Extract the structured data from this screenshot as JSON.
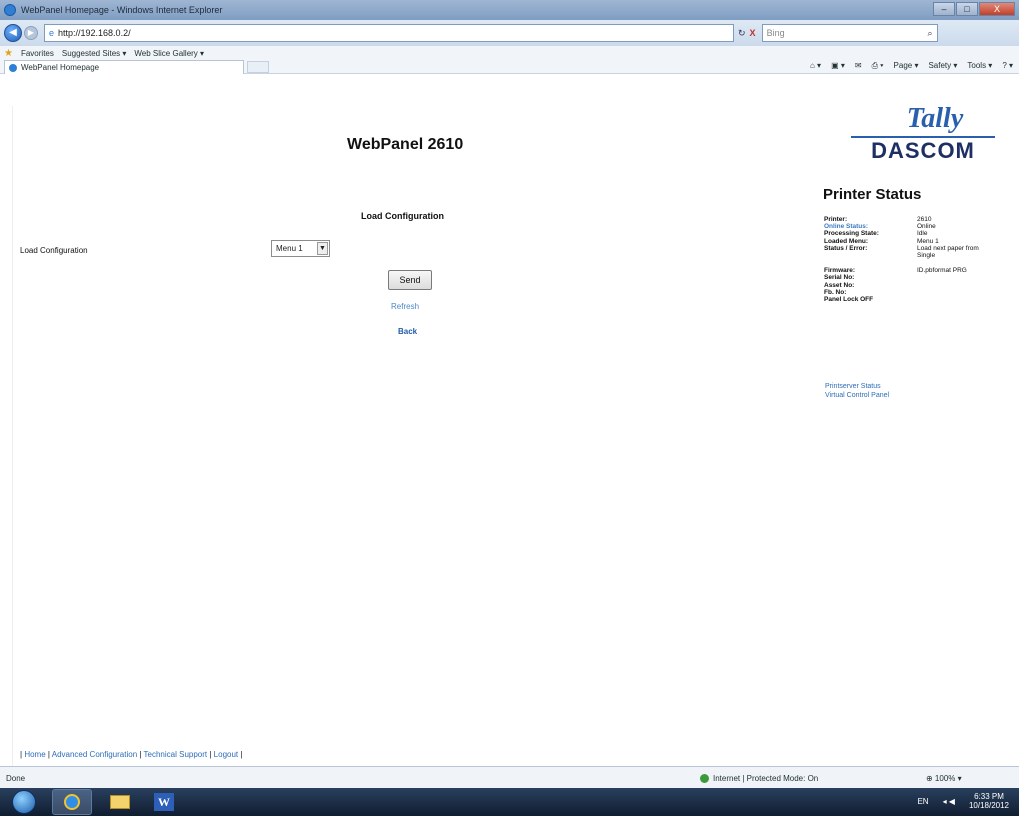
{
  "window": {
    "title": "WebPanel Homepage - Windows Internet Explorer",
    "minimize": "–",
    "maximize": "□",
    "close": "X"
  },
  "addressbar": {
    "back": "◀",
    "forward": "▶",
    "url": "http://192.168.0.2/",
    "search_placeholder": "Bing",
    "refresh": "↻",
    "stop": "X"
  },
  "favorites": {
    "favorites_label": "Favorites",
    "suggested_sites": "Suggested Sites ▾",
    "web_slice_gallery": "Web Slice Gallery ▾"
  },
  "tabs": [
    {
      "label": "WebPanel Homepage"
    }
  ],
  "commandbar": {
    "home": "⌂ ▾",
    "feeds": "▣ ▾",
    "mail": "✉",
    "print": "⎙ ▾",
    "page": "Page ▾",
    "safety": "Safety ▾",
    "tools": "Tools ▾",
    "help": "? ▾"
  },
  "page": {
    "title": "WebPanel 2610",
    "section_title": "Load Configuration",
    "config_label": "Load Configuration",
    "config_selected": "Menu 1",
    "send_label": "Send",
    "refresh_label": "Refresh",
    "back_label": "Back"
  },
  "logo": {
    "tally": "Tally",
    "dascom": "DASCOM"
  },
  "printer_status": {
    "title": "Printer Status",
    "rows": [
      {
        "key": "Printer:",
        "value": "2610"
      },
      {
        "key": "Online Status:",
        "value": "Online"
      },
      {
        "key": "Processing State:",
        "value": "Idle"
      },
      {
        "key": "Loaded Menu:",
        "value": "Menu 1"
      },
      {
        "key": "Status / Error:",
        "value": "Load next paper from"
      },
      {
        "key": "",
        "value": "Single"
      },
      {
        "key": "Firmware:",
        "value": "ID.pbformat PRG"
      },
      {
        "key": "Serial No:",
        "value": ""
      },
      {
        "key": "Asset No:",
        "value": ""
      },
      {
        "key": "Fb. No:",
        "value": ""
      },
      {
        "key": "Panel Lock OFF",
        "value": ""
      }
    ],
    "printserver_link": "Printserver Status",
    "virtual_panel_link": "Virtual Control Panel"
  },
  "footer": {
    "sep": "|",
    "home": "Home",
    "advanced": "Advanced Configuration",
    "support": "Technical Support",
    "logout": "Logout"
  },
  "statusbar": {
    "done": "Done",
    "zone": "Internet | Protected Mode: On",
    "zoom": "⊕ 100% ▾"
  },
  "taskbar": {
    "lang": "EN",
    "time": "6:33 PM",
    "date": "10/18/2012"
  },
  "colors": {
    "link": "#2d6db8",
    "logo_blue": "#2a5fae",
    "logo_navy": "#1e2f63"
  }
}
